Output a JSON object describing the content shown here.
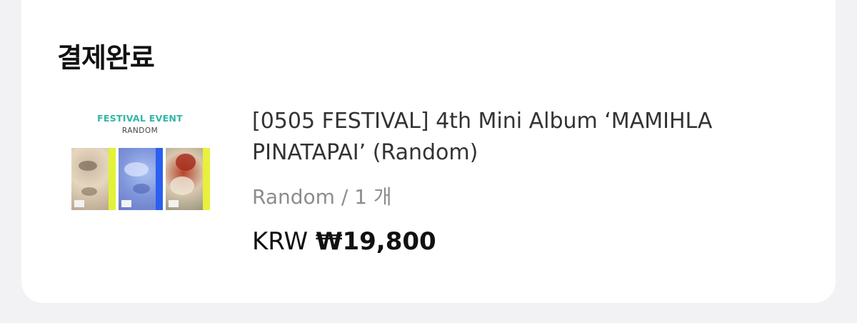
{
  "page": {
    "title": "결제완료"
  },
  "product": {
    "thumbnail": {
      "event_title": "FESTIVAL EVENT",
      "event_subtitle": "RANDOM"
    },
    "name": "[0505 FESTIVAL] 4th Mini Album ‘MAMIHLA PINATAPAI’ (Random)",
    "option": "Random / 1 개",
    "price_currency": "KRW",
    "price_amount": "₩19,800"
  },
  "colors": {
    "background": "#f2f2f4",
    "card": "#ffffff",
    "accent_teal": "#2fb7a4",
    "option_gray": "#8c8c8c"
  }
}
